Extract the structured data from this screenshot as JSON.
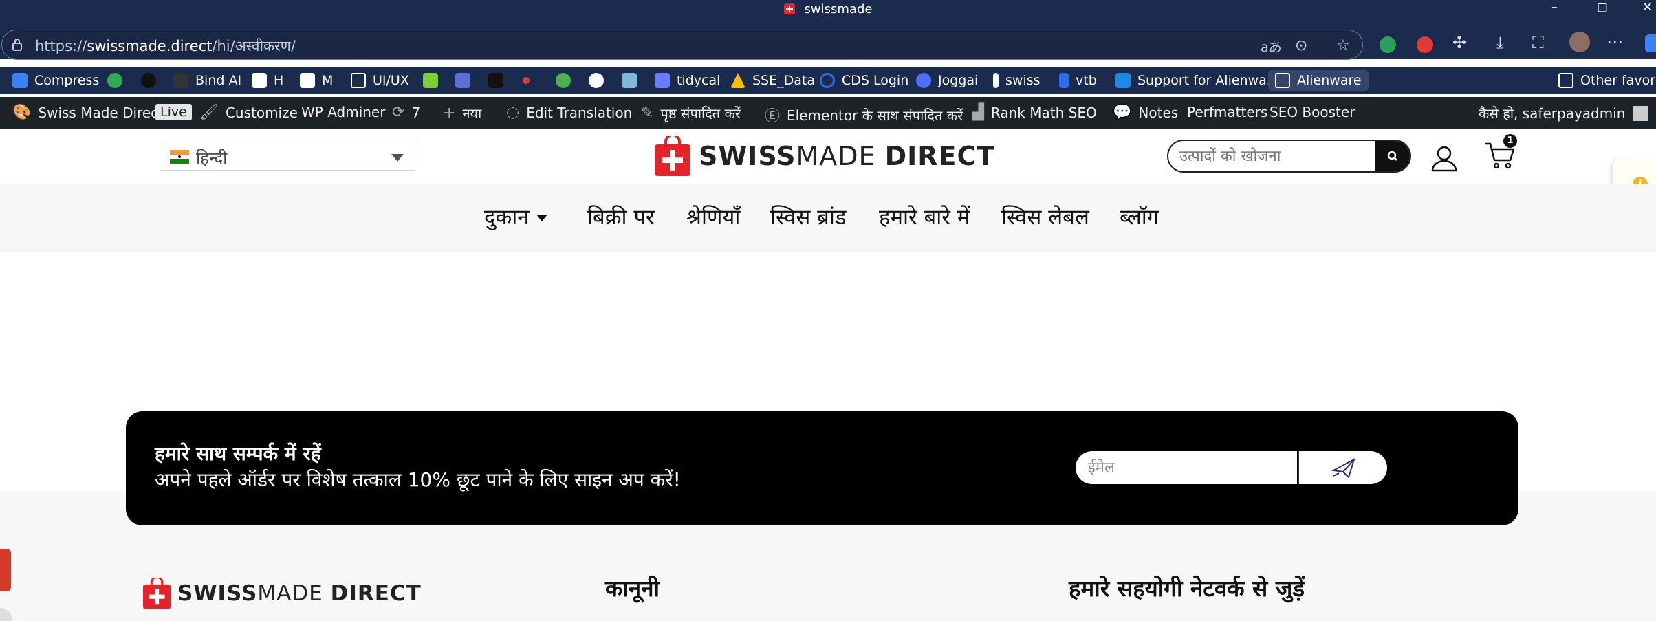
{
  "browser": {
    "tab_title": "swissmade",
    "url_prefix": "https://",
    "url_domain": "swissmade.direct",
    "url_path": "/hi/अस्वीकरण/",
    "window_controls": [
      "–",
      "❐",
      "✕"
    ]
  },
  "bookmarks": [
    {
      "label": "Compress",
      "color": "#3b82f6"
    },
    {
      "label": "",
      "icon_text": "fi",
      "color": "#34a853"
    },
    {
      "label": "",
      "icon_text": "up",
      "color": "#111111"
    },
    {
      "label": "Bind AI",
      "color": "#222222"
    },
    {
      "label": "H",
      "color": "#ffffff"
    },
    {
      "label": "M",
      "color": "#ffffff"
    },
    {
      "label": "UI/UX",
      "icon": "folder-icon"
    },
    {
      "label": "",
      "color": "#7ccf3b"
    },
    {
      "label": "",
      "color": "#5b6fd6"
    },
    {
      "label": "",
      "icon_text": "SY",
      "color": "#111111"
    },
    {
      "label": "",
      "color": "#e53935"
    },
    {
      "label": "",
      "color": "#4caf50"
    },
    {
      "label": "",
      "color": "#ffffff"
    },
    {
      "label": "",
      "icon_text": "KF",
      "color": "#7fb6d9"
    },
    {
      "label": "tidycal",
      "color": "#6b7cff"
    },
    {
      "label": "SSE_Data",
      "color": "#fbbc04"
    },
    {
      "label": "CDS Login",
      "color": "#2d6cdf"
    },
    {
      "label": "Joggai",
      "color": "#4f6ef7"
    },
    {
      "label": "swiss",
      "color": "#ffffff"
    },
    {
      "label": "vtb",
      "color": "#2b6ef0"
    },
    {
      "label": "Support for Alienwa...",
      "color": "#1e88e5"
    },
    {
      "label": "Alienware",
      "icon": "folder-icon"
    },
    {
      "label": "Other favorites",
      "icon": "folder-icon"
    }
  ],
  "wpbar": {
    "site": "Swiss Made Direct",
    "live": "Live",
    "customize": "Customize",
    "wp_adminer": "WP Adminer",
    "updates_count": "7",
    "new": "नया",
    "edit_translation": "Edit Translation",
    "edit_page": "पृष्ठ संपादित करें",
    "elementor": "Elementor के साथ संपादित करें",
    "rank_math": "Rank Math SEO",
    "notes": "Notes",
    "perfmatters": "Perfmatters",
    "seo_booster": "SEO Booster",
    "greeting": "कैसे हो, saferpayadmin"
  },
  "header": {
    "language": "हिन्दी",
    "logo_bold": "SWISS",
    "logo_light": "MADE ",
    "logo_end": "DIRECT",
    "search_placeholder": "उत्पादों को खोजना",
    "cart_count": "1"
  },
  "nav": {
    "items": [
      "दुकान",
      "बिक्री पर",
      "श्रेणियाँ",
      "स्विस ब्रांड",
      "हमारे बारे में",
      "स्विस लेबल",
      "ब्लॉग"
    ]
  },
  "newsletter": {
    "heading": "हमारे साथ सम्पर्क में रहें",
    "text": "अपने पहले ऑर्डर पर विशेष तत्काल 10% छूट पाने के लिए साइन अप करें!",
    "email_placeholder": "ईमेल"
  },
  "footer": {
    "col2_heading": "कानूनी",
    "col3_heading": "हमारे सहयोगी नेटवर्क से जुड़ें"
  },
  "colors": {
    "browser_bg": "#1b2b4e",
    "wpbar_bg": "#1d2327",
    "brand_red": "#e3242b",
    "newsletter_bg": "#000000"
  }
}
